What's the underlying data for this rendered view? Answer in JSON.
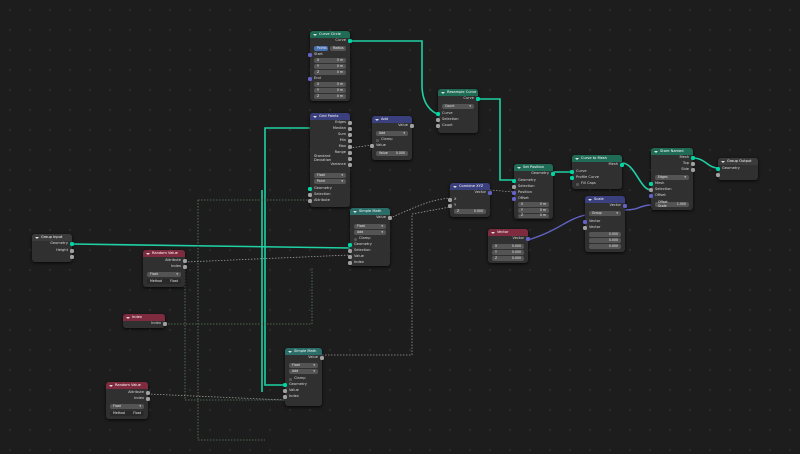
{
  "nodes": {
    "group_input": {
      "title": "Group Input",
      "geometry": "Geometry",
      "height": "Height"
    },
    "curve_circle": {
      "title": "Curve Circle",
      "curve": "Curve",
      "mode_a": "Points",
      "mode_b": "Radius",
      "start": "Start",
      "middle": "Mid",
      "end": "End",
      "x": "X",
      "y": "Y",
      "z": "Z",
      "val": "0 m"
    },
    "grid_points": {
      "title": "Grid Points",
      "edges": "Edges",
      "median": "Median",
      "sum": "Sum",
      "min": "Min",
      "max": "Max",
      "range": "Range",
      "std": "Standard Deviation",
      "variance": "Variance",
      "float": "Float",
      "point": "Point",
      "geometry": "Geometry",
      "selection": "Selection",
      "attribute": "Attribute"
    },
    "add": {
      "title": "Add",
      "value": "Value",
      "op": "Add",
      "clamp": "Clamp",
      "value_in": "Value",
      "num": "0.000"
    },
    "resample_curve": {
      "title": "Resample Curve",
      "curve": "Curve",
      "count": "Count",
      "curve_in": "Curve",
      "selection": "Selection",
      "count_in": "Count"
    },
    "simple_math": {
      "title": "Simple Math",
      "value": "Value",
      "float": "Float",
      "op": "Add",
      "clamp": "Clamp",
      "geometry": "Geometry",
      "selection": "Selection",
      "value_in": "Value",
      "index": "Index"
    },
    "combine_xyz": {
      "title": "Combine XYZ",
      "vector": "Vector",
      "x": "X",
      "y": "Y",
      "z": "Z",
      "val": "0.000"
    },
    "set_position": {
      "title": "Set Position",
      "geometry": "Geometry",
      "geometry_in": "Geometry",
      "selection": "Selection",
      "position": "Position",
      "offset": "Offset",
      "x": "X",
      "y": "Y",
      "z": "Z",
      "num": "0 m"
    },
    "curve_to_mesh": {
      "title": "Curve to Mesh",
      "mesh": "Mesh",
      "curve": "Curve",
      "profile": "Profile Curve",
      "fill": "Fill Caps"
    },
    "store_attr": {
      "title": "Store Named",
      "mesh": "Mesh",
      "top": "Top",
      "side": "Side",
      "edges": "Edges",
      "faces": "Faces",
      "selection": "Selection",
      "offset": "Offset",
      "offset_scale": "Offset Scale",
      "num": "1.000"
    },
    "group_output": {
      "title": "Group Output",
      "geometry": "Geometry"
    },
    "vector": {
      "title": "Vector",
      "vector": "Vector",
      "x": "X",
      "y": "Y",
      "z": "Z",
      "val": "0.000"
    },
    "scale": {
      "title": "Scale",
      "vector": "Vector",
      "group": "Group",
      "vector_in": "Vector",
      "scale": "Scale",
      "val": "0.000"
    },
    "random_a": {
      "title": "Random Value",
      "attribute": "Attribute",
      "index": "Index",
      "float": "Float",
      "method": "Method",
      "method_val": "Float"
    },
    "index": {
      "title": "Index",
      "index": "Index"
    },
    "simple_math2": {
      "title": "Simple Math",
      "value": "Value",
      "float": "Float",
      "op": "Add",
      "clamp": "Clamp",
      "geometry": "Geometry",
      "value_in": "Value",
      "index": "Index"
    },
    "random_b": {
      "title": "Random Value",
      "attribute": "Attribute",
      "index": "Index",
      "float": "Float",
      "method": "Method",
      "method_val": "Float"
    }
  },
  "colors": {
    "geometry_link": "#00d6a3",
    "float_link": "#a1a1a1",
    "vector_link": "#6363c7",
    "field_link": "#6e8e6e"
  }
}
